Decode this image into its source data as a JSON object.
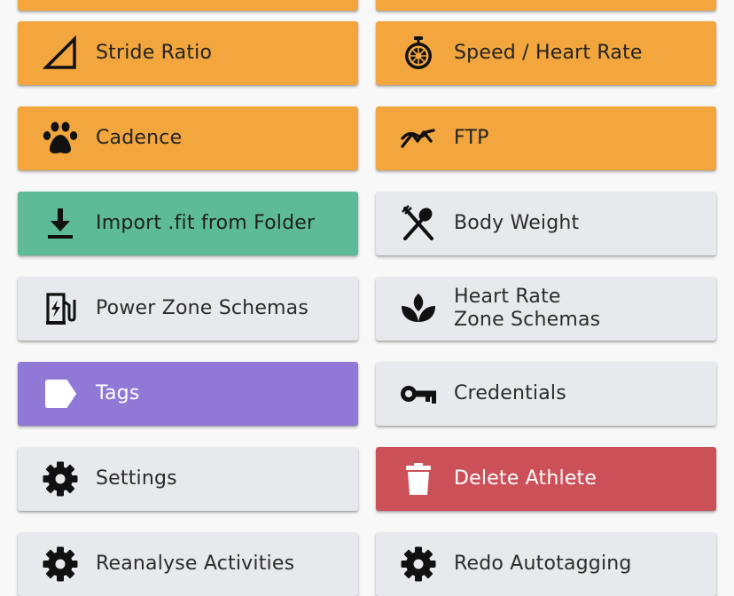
{
  "tiles": [
    {
      "key": "stride_ratio",
      "label": [
        "Stride Ratio"
      ],
      "icon": "triangle-ruler-icon",
      "color": "#f2a63d"
    },
    {
      "key": "speed_hr",
      "label": [
        "Speed / Heart Rate"
      ],
      "icon": "stopwatch-icon",
      "color": "#f2a63d"
    },
    {
      "key": "cadence",
      "label": [
        "Cadence"
      ],
      "icon": "paw-icon",
      "color": "#f2a63d"
    },
    {
      "key": "ftp",
      "label": [
        "FTP"
      ],
      "icon": "trending-line-icon",
      "color": "#f2a63d"
    },
    {
      "key": "import_fit",
      "label": [
        "Import .fit from Folder"
      ],
      "icon": "download-icon",
      "color": "#5ebb99"
    },
    {
      "key": "body_weight",
      "label": [
        "Body Weight"
      ],
      "icon": "fork-spoon-icon",
      "color": "#e8e9ec"
    },
    {
      "key": "power_zones",
      "label": [
        "Power Zone Schemas"
      ],
      "icon": "ev-station-icon",
      "color": "#e8e9ec"
    },
    {
      "key": "hr_zones",
      "label": [
        "Heart Rate",
        "Zone Schemas"
      ],
      "icon": "spa-leaf-icon",
      "color": "#e8e9ec"
    },
    {
      "key": "tags",
      "label": [
        "Tags"
      ],
      "icon": "tag-icon",
      "color": "#9079d6"
    },
    {
      "key": "credentials",
      "label": [
        "Credentials"
      ],
      "icon": "key-icon",
      "color": "#e8e9ec"
    },
    {
      "key": "settings",
      "label": [
        "Settings"
      ],
      "icon": "gear-icon",
      "color": "#e8e9ec"
    },
    {
      "key": "delete_athlete",
      "label": [
        "Delete Athlete"
      ],
      "icon": "trash-icon",
      "color": "#cc5058"
    },
    {
      "key": "reanalyse",
      "label": [
        "Reanalyse Activities"
      ],
      "icon": "gear-icon",
      "color": "#e8e9ec"
    },
    {
      "key": "redo_autotagging",
      "label": [
        "Redo Autotagging"
      ],
      "icon": "gear-icon",
      "color": "#e8e9ec"
    }
  ]
}
